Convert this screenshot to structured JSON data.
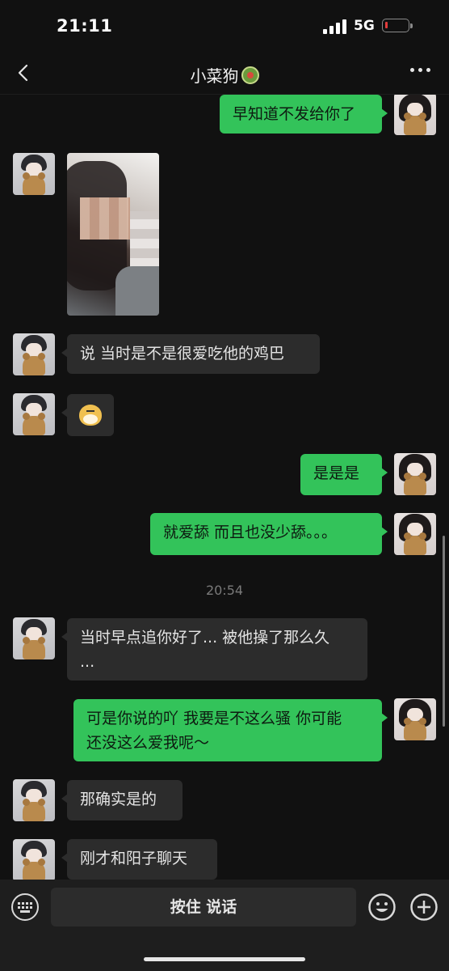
{
  "status_bar": {
    "time": "21:11",
    "network": "5G"
  },
  "nav": {
    "title": "小菜狗"
  },
  "messages": [
    {
      "side": "out",
      "type": "text",
      "text": "早知道不发给你了"
    },
    {
      "side": "in",
      "type": "image"
    },
    {
      "side": "in",
      "type": "text",
      "text": "说 当时是不是很爱吃他的鸡巴"
    },
    {
      "side": "in",
      "type": "sticker",
      "icon": "doge-emoji-icon"
    },
    {
      "side": "out",
      "type": "text",
      "text": "是是是"
    },
    {
      "side": "out",
      "type": "text",
      "text": "就爱舔 而且也没少舔。。。"
    },
    {
      "type": "timestamp",
      "text": "20:54"
    },
    {
      "side": "in",
      "type": "text",
      "text": "当时早点追你好了... 被他操了那么久\n..."
    },
    {
      "side": "out",
      "type": "text",
      "text": "可是你说的吖 我要是不这么骚 你可能\n还没这么爱我呢～"
    },
    {
      "side": "in",
      "type": "text",
      "text": "那确实是的"
    },
    {
      "side": "in",
      "type": "text",
      "text": "刚才和阳子聊天"
    }
  ],
  "input_bar": {
    "voice_label": "按住 说话"
  },
  "colors": {
    "background": "#111111",
    "incoming_bubble": "#2c2c2c",
    "outgoing_bubble": "#33c35a"
  }
}
